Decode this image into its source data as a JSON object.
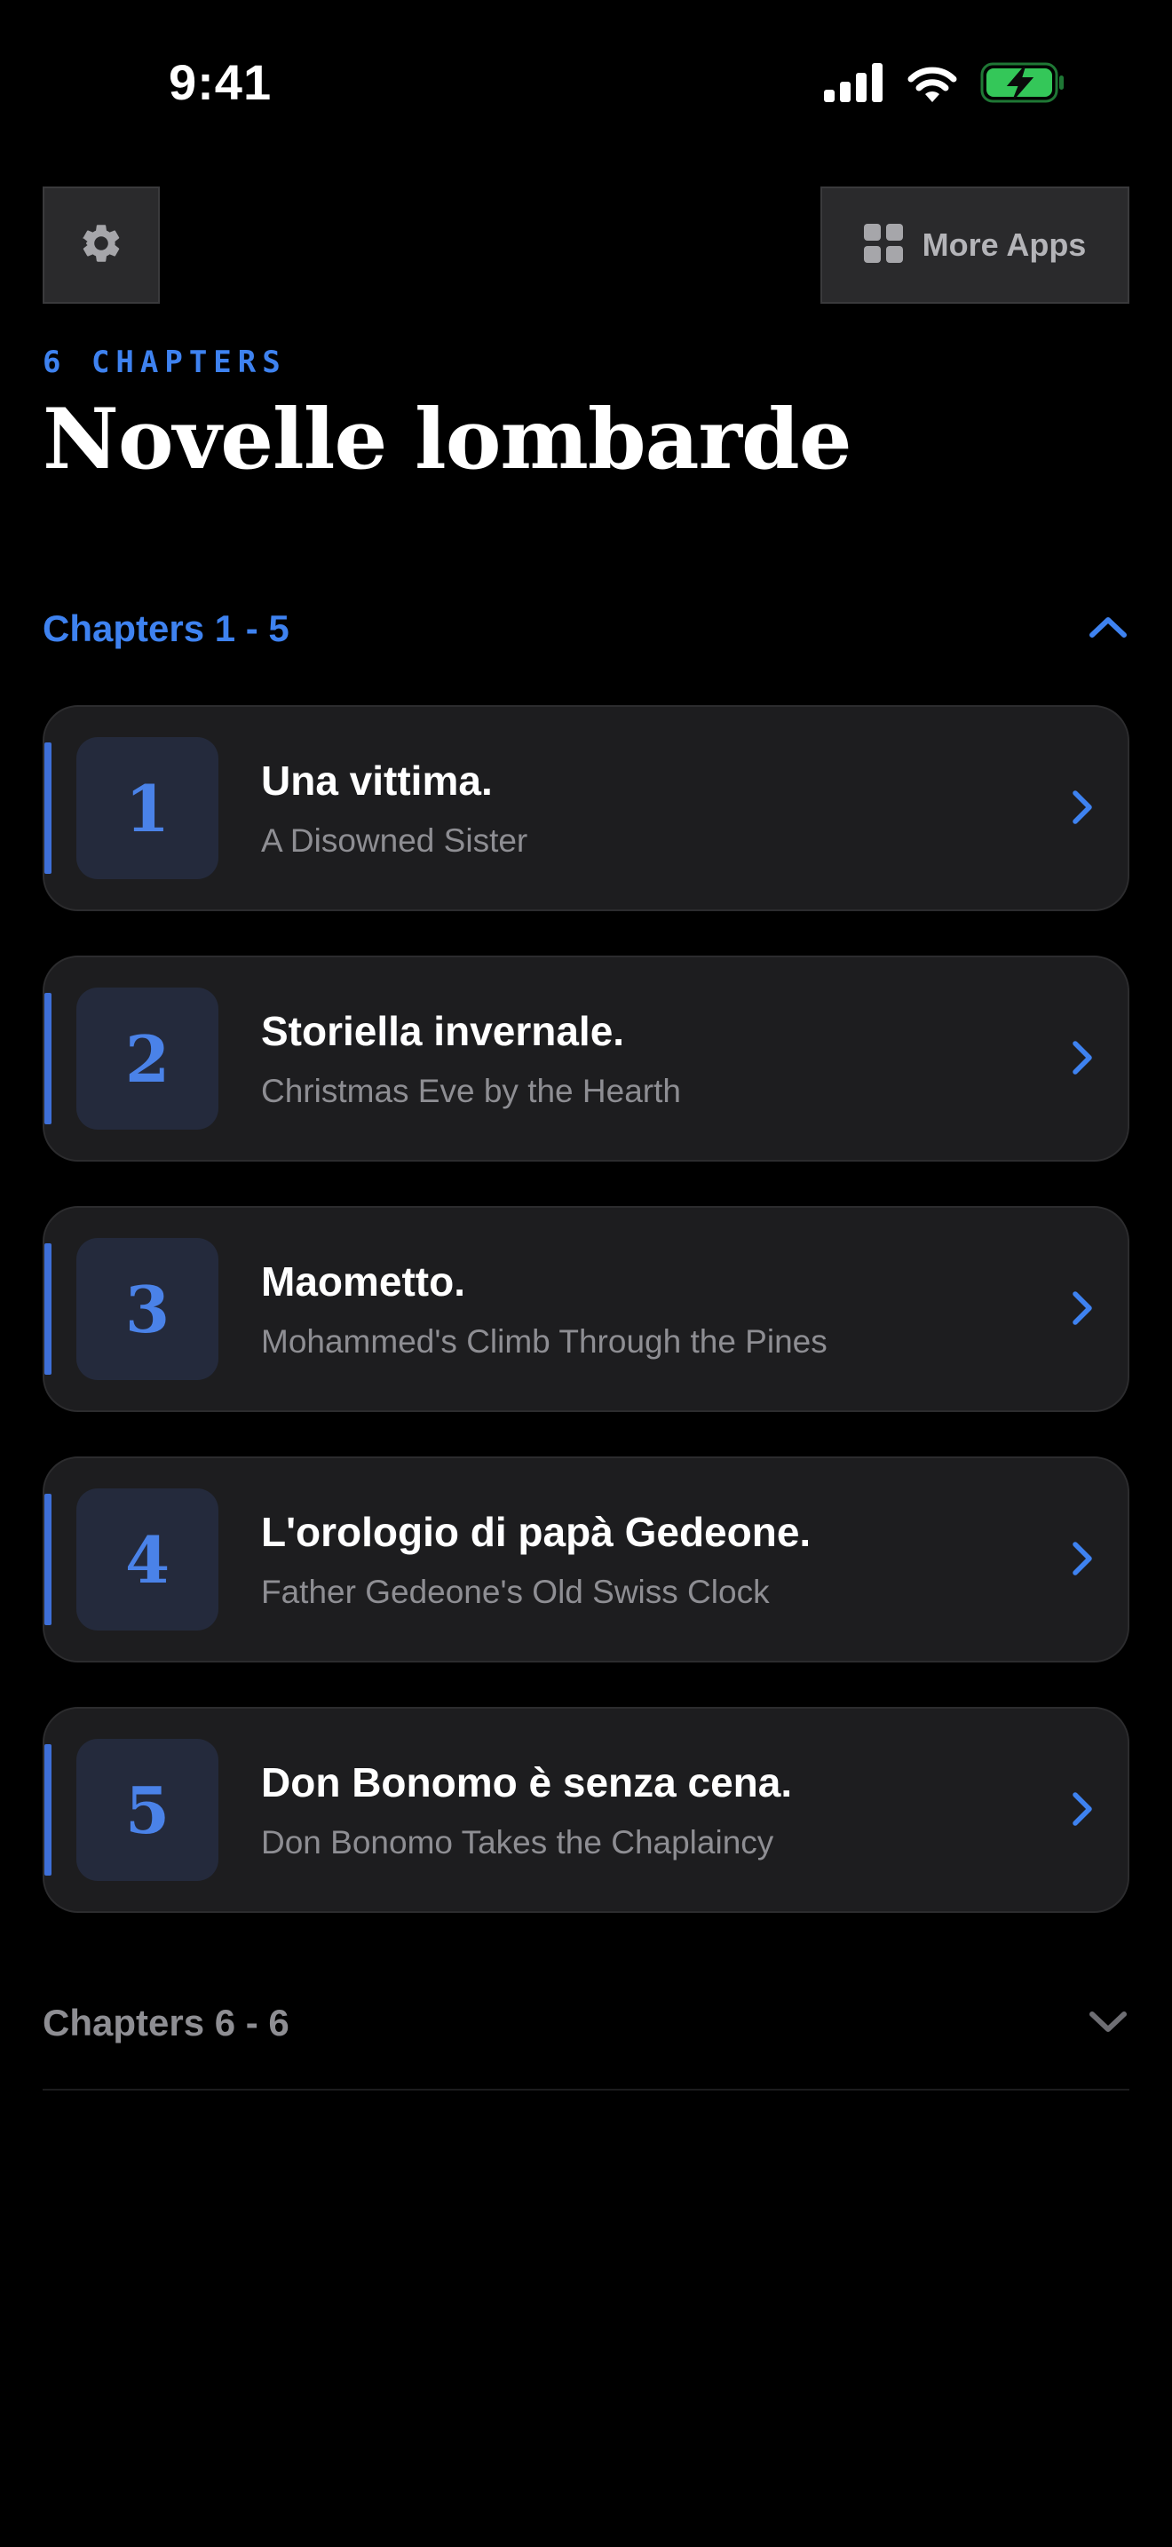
{
  "status_bar": {
    "time": "9:41"
  },
  "toolbar": {
    "settings_icon": "gear-icon",
    "more_apps_label": "More Apps",
    "more_apps_icon": "grid-icon"
  },
  "header": {
    "chapter_count": "6 CHAPTERS",
    "title": "Novelle lombarde"
  },
  "sections": [
    {
      "label": "Chapters 1 - 5",
      "expanded": true,
      "icon": "chevron-up-icon"
    },
    {
      "label": "Chapters 6 - 6",
      "expanded": false,
      "icon": "chevron-down-icon"
    }
  ],
  "chapters": [
    {
      "number": "1",
      "title": "Una vittima.",
      "subtitle": "A Disowned Sister"
    },
    {
      "number": "2",
      "title": "Storiella invernale.",
      "subtitle": "Christmas Eve by the Hearth"
    },
    {
      "number": "3",
      "title": "Maometto.",
      "subtitle": "Mohammed's Climb Through the Pines"
    },
    {
      "number": "4",
      "title": "L'orologio di papà Gedeone.",
      "subtitle": "Father Gedeone's Old Swiss Clock"
    },
    {
      "number": "5",
      "title": "Don Bonomo è senza cena.",
      "subtitle": "Don Bonomo Takes the Chaplaincy"
    }
  ],
  "colors": {
    "accent": "#3e82f0",
    "background": "#000000",
    "card": "#1d1d1f",
    "battery": "#34c759"
  }
}
